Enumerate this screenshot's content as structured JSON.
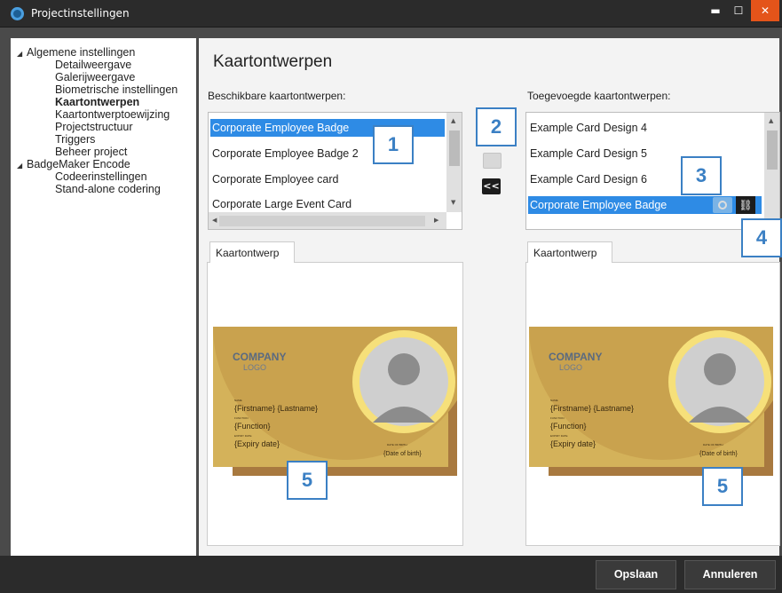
{
  "window": {
    "title": "Projectinstellingen",
    "min": "▬",
    "max": "☐",
    "close": "✕"
  },
  "tree": {
    "items": [
      {
        "label": "Algemene instellingen"
      },
      {
        "label": "Detailweergave"
      },
      {
        "label": "Galerijweergave"
      },
      {
        "label": "Biometrische instellingen"
      },
      {
        "label": "Kaartontwerpen"
      },
      {
        "label": "Kaartontwerptoewijzing"
      },
      {
        "label": "Projectstructuur"
      },
      {
        "label": "Triggers"
      },
      {
        "label": "Beheer project"
      },
      {
        "label": "BadgeMaker Encode"
      },
      {
        "label": "Codeerinstellingen"
      },
      {
        "label": "Stand-alone codering"
      }
    ]
  },
  "main": {
    "title": "Kaartontwerpen",
    "available": {
      "caption": "Beschikbare kaartontwerpen:",
      "items": [
        "Corporate Employee Badge",
        "Corporate Employee Badge 2",
        "Corporate Employee card",
        "Corporate Large Event Card"
      ]
    },
    "added": {
      "caption": "Toegevoegde kaartontwerpen:",
      "items": [
        "Example Card Design 4",
        "Example Card Design 5",
        "Example Card Design 6",
        "Corporate Employee Badge"
      ]
    },
    "move_left_label": "<<",
    "tab_label": "Kaartontwerp",
    "card": {
      "logo_line1": "COMPANY",
      "logo_line2": "LOGO",
      "name_caption": "NAME",
      "name_value": "{Firstname} {Lastname}",
      "function_caption": "FUNCTION",
      "function_value": "{Function}",
      "expiry_caption": "EXPIRY DATE",
      "expiry_value": "{Expiry date}",
      "dob_caption": "DATE OF BIRTH",
      "dob_value": "{Date of birth}"
    }
  },
  "callouts": {
    "c1": "1",
    "c2": "2",
    "c3": "3",
    "c4": "4",
    "c5a": "5",
    "c5b": "5"
  },
  "footer": {
    "save_label": "Opslaan",
    "cancel_label": "Annuleren"
  },
  "colors": {
    "accent": "#2e8be5",
    "callout": "#3b80c4",
    "close": "#e4541a"
  }
}
